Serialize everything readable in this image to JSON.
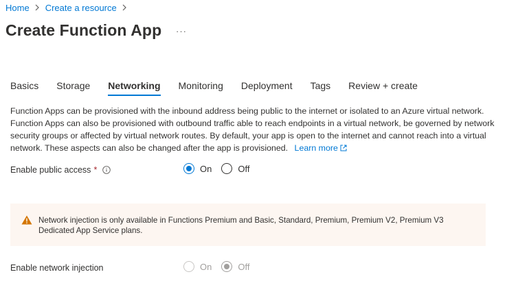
{
  "breadcrumb": {
    "items": [
      "Home",
      "Create a resource"
    ]
  },
  "page": {
    "title": "Create Function App",
    "more_label": "···"
  },
  "tabs": [
    {
      "label": "Basics",
      "active": false
    },
    {
      "label": "Storage",
      "active": false
    },
    {
      "label": "Networking",
      "active": true
    },
    {
      "label": "Monitoring",
      "active": false
    },
    {
      "label": "Deployment",
      "active": false
    },
    {
      "label": "Tags",
      "active": false
    },
    {
      "label": "Review + create",
      "active": false
    }
  ],
  "description": {
    "text": "Function Apps can be provisioned with the inbound address being public to the internet or isolated to an Azure virtual network. Function Apps can also be provisioned with outbound traffic able to reach endpoints in a virtual network, be governed by network security groups or affected by virtual network routes. By default, your app is open to the internet and cannot reach into a virtual network. These aspects can also be changed after the app is provisioned.",
    "link_label": "Learn more"
  },
  "public_access": {
    "label": "Enable public access",
    "required_mark": "*",
    "options": [
      "On",
      "Off"
    ],
    "selected": "On"
  },
  "warning": {
    "text": "Network injection is only available in Functions Premium and Basic, Standard, Premium, Premium V2, Premium V3 Dedicated App Service plans."
  },
  "network_injection": {
    "label": "Enable network injection",
    "options": [
      "On",
      "Off"
    ],
    "selected": "Off",
    "disabled": true
  },
  "colors": {
    "accent": "#0078d4",
    "warning_icon": "#d47500",
    "warning_bg": "#fdf6f1"
  },
  "icons": {
    "breadcrumb_separator": "chevron-right-icon",
    "info": "info-icon",
    "external_link": "external-link-icon",
    "warning": "warning-icon"
  }
}
